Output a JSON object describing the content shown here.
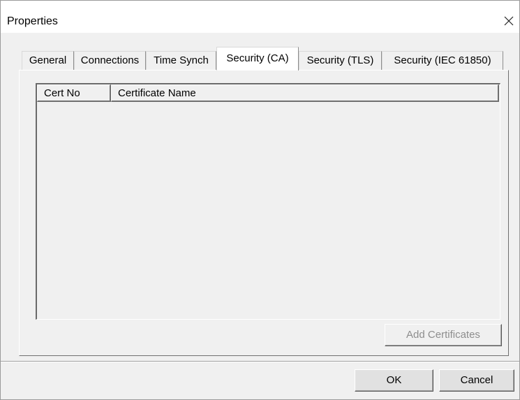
{
  "window": {
    "title": "Properties",
    "close_icon": "close-icon"
  },
  "tabs": [
    {
      "label": "General",
      "active": false
    },
    {
      "label": "Connections",
      "active": false
    },
    {
      "label": "Time Synch",
      "active": false
    },
    {
      "label": "Security (CA)",
      "active": true
    },
    {
      "label": "Security (TLS)",
      "active": false
    },
    {
      "label": "Security (IEC 61850)",
      "active": false
    }
  ],
  "certificate_list": {
    "columns": [
      "Cert No",
      "Certificate Name"
    ],
    "rows": []
  },
  "panel": {
    "add_certificates_label": "Add Certificates",
    "add_certificates_enabled": false
  },
  "dialog_buttons": {
    "ok_label": "OK",
    "cancel_label": "Cancel"
  }
}
